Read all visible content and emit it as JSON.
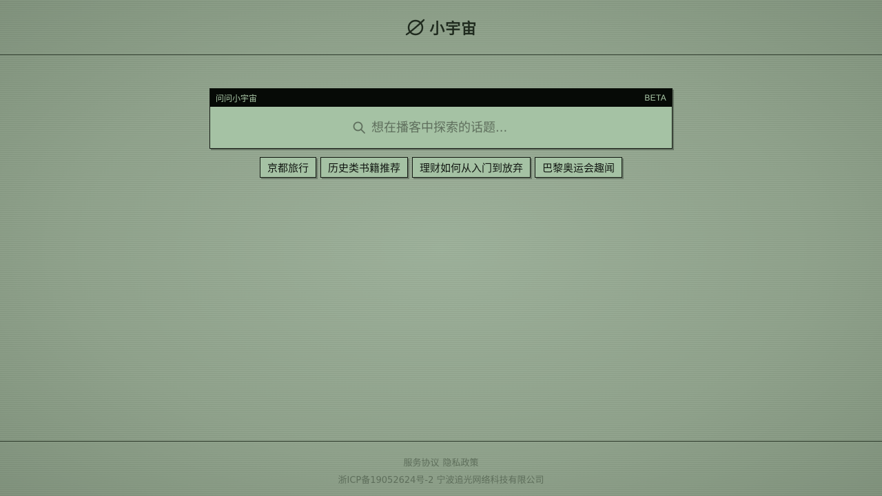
{
  "header": {
    "logo_text": "小宇宙",
    "logo_icon": "planet-icon"
  },
  "search_card": {
    "title": "问问小宇宙",
    "badge": "BETA",
    "search_icon": "search-icon",
    "placeholder": "想在播客中探索的话题..."
  },
  "suggestions": [
    {
      "label": "京都旅行"
    },
    {
      "label": "历史类书籍推荐"
    },
    {
      "label": "理财如何从入门到放弃"
    },
    {
      "label": "巴黎奥运会趣闻"
    }
  ],
  "footer": {
    "terms_label": "服务协议",
    "privacy_label": "隐私政策",
    "icp_text": "浙ICP备19052624号-2 宁波追光网络科技有限公司"
  },
  "colors": {
    "background": "#93a68f",
    "card": "#a5c2a4",
    "card_bar": "#060a06",
    "text_dark": "#101510",
    "muted": "#5e6e5b"
  }
}
